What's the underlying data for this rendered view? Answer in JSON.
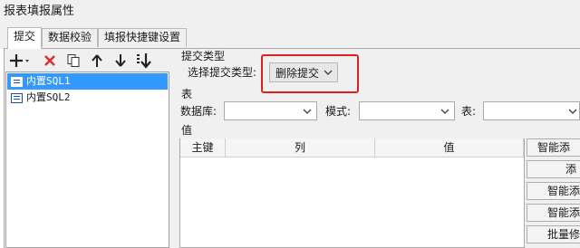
{
  "window": {
    "title": "报表填报属性"
  },
  "tabs": [
    {
      "label": "提交",
      "active": true
    },
    {
      "label": "数据校验",
      "active": false
    },
    {
      "label": "填报快捷键设置",
      "active": false
    }
  ],
  "toolbar": {
    "icons": [
      "add-icon",
      "delete-icon",
      "copy-icon",
      "move-up-icon",
      "move-down-icon",
      "sort-icon"
    ]
  },
  "submit_list": {
    "items": [
      {
        "label": "内置SQL1",
        "selected": true
      },
      {
        "label": "内置SQL2",
        "selected": false
      }
    ]
  },
  "submit_type": {
    "section_label": "提交类型",
    "select_label": "选择提交类型:",
    "value": "删除提交"
  },
  "table_section": {
    "section_label": "表",
    "database_label": "数据库:",
    "database_value": "",
    "schema_label": "模式:",
    "schema_value": "",
    "table_label": "表:",
    "table_value": ""
  },
  "values_section": {
    "section_label": "值",
    "columns": [
      "主键",
      "列",
      "值"
    ]
  },
  "side_buttons": [
    "智能添",
    "添",
    "智能添",
    "智能添",
    "批量修"
  ],
  "colors": {
    "selection": "#3399ff",
    "highlight_box": "#e02020"
  }
}
